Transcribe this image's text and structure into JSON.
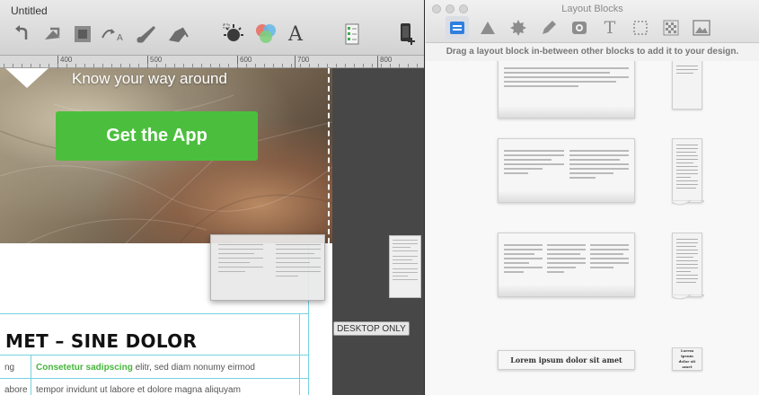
{
  "editor": {
    "title": "Untitled",
    "toolbar_icons": [
      "undo-icon",
      "redo-icon",
      "crop-icon",
      "text-path-icon",
      "paint-brush-icon",
      "eraser-icon",
      "effects-icon",
      "color-mixer-icon",
      "font-icon",
      "checklist-icon",
      "device-add-icon"
    ],
    "font_glyph": "A",
    "ruler_labels": [
      "400",
      "500",
      "600",
      "700",
      "800"
    ],
    "hero": {
      "headline": "Know your way around",
      "cta_label": "Get the App"
    },
    "lower": {
      "heading": "MET – SINE DOLOR",
      "row1_left": "ng",
      "row1_green": "Consetetur sadipscing",
      "row1_rest": " elitr, sed diam nonumy eirmod",
      "row2_left": "abore",
      "row2_text": "tempor invidunt ut labore et dolore magna aliquyam"
    },
    "desktop_only_label": "DESKTOP ONLY"
  },
  "panel": {
    "title": "Layout Blocks",
    "tabs": [
      "layout-block-icon",
      "shape-icon",
      "badge-icon",
      "pen-icon",
      "media-icon",
      "text-icon",
      "selection-icon",
      "pattern-icon",
      "image-icon"
    ],
    "text_tab_glyph": "T",
    "hint": "Drag a layout block in-between other blocks to add it to your design.",
    "text_block_title": "Lorem ipsum dolor sit amet",
    "slim_block_title": "Lorem ipsum dolor sit amet"
  },
  "colors": {
    "accent_blue": "#2f7fe0",
    "cta_green": "#4bbf3d",
    "guide_cyan": "#76d3df"
  }
}
